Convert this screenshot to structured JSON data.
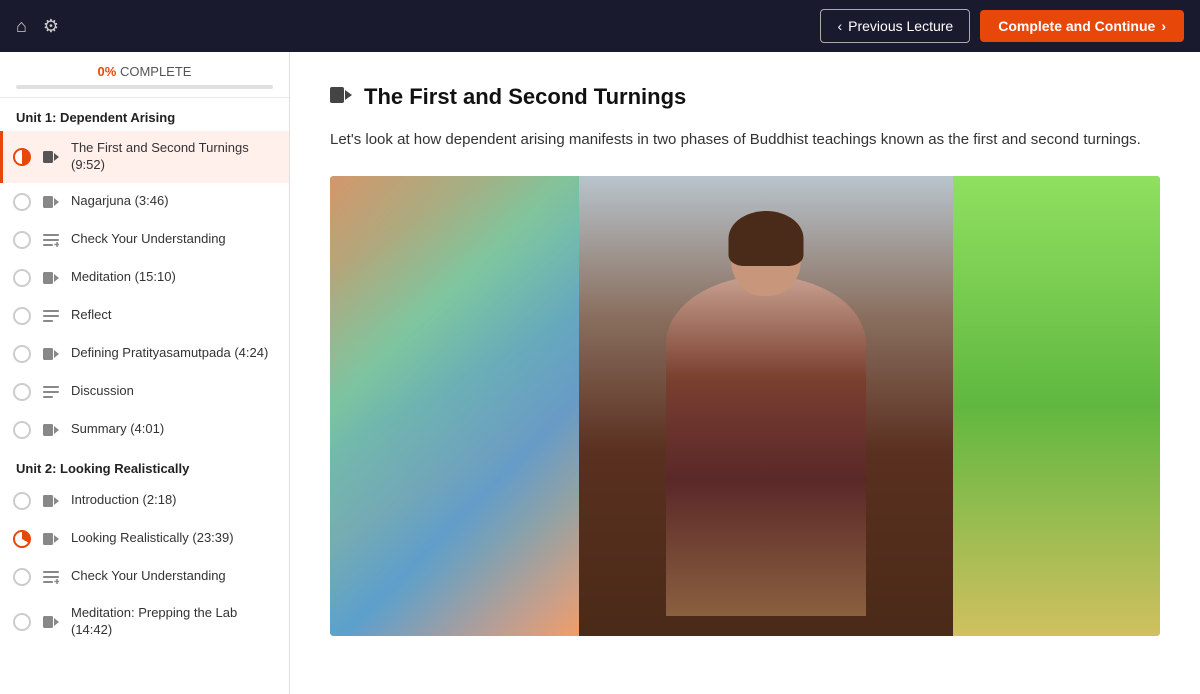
{
  "nav": {
    "prev_label": "Previous Lecture",
    "complete_label": "Complete and Continue"
  },
  "progress": {
    "percent": "0%",
    "label": "COMPLETE"
  },
  "units": [
    {
      "title": "Unit 1: Dependent Arising",
      "items": [
        {
          "id": "item-first-second",
          "label": "The First and Second Turnings (9:52)",
          "type": "video",
          "active": true,
          "status": "half"
        },
        {
          "id": "item-nagarjuna",
          "label": "Nagarjuna (3:46)",
          "type": "video",
          "active": false,
          "status": "empty"
        },
        {
          "id": "item-check1",
          "label": "Check Your Understanding",
          "type": "quiz",
          "active": false,
          "status": "empty"
        },
        {
          "id": "item-meditation",
          "label": "Meditation (15:10)",
          "type": "video",
          "active": false,
          "status": "empty"
        },
        {
          "id": "item-reflect",
          "label": "Reflect",
          "type": "text",
          "active": false,
          "status": "empty"
        },
        {
          "id": "item-defining",
          "label": "Defining Pratityasamutpada (4:24)",
          "type": "video",
          "active": false,
          "status": "empty"
        },
        {
          "id": "item-discussion",
          "label": "Discussion",
          "type": "text",
          "active": false,
          "status": "empty"
        },
        {
          "id": "item-summary",
          "label": "Summary (4:01)",
          "type": "video",
          "active": false,
          "status": "empty"
        }
      ]
    },
    {
      "title": "Unit 2: Looking Realistically",
      "items": [
        {
          "id": "item-intro",
          "label": "Introduction (2:18)",
          "type": "video",
          "active": false,
          "status": "empty"
        },
        {
          "id": "item-looking",
          "label": "Looking Realistically (23:39)",
          "type": "video",
          "active": false,
          "status": "partial"
        },
        {
          "id": "item-check2",
          "label": "Check Your Understanding",
          "type": "quiz",
          "active": false,
          "status": "empty"
        },
        {
          "id": "item-meditation2",
          "label": "Meditation: Prepping the Lab (14:42)",
          "type": "video",
          "active": false,
          "status": "empty"
        }
      ]
    }
  ],
  "lecture": {
    "title": "The First and Second Turnings",
    "description": "Let's look at how dependent arising manifests in two phases of Buddhist teachings known as the first and second turnings."
  }
}
